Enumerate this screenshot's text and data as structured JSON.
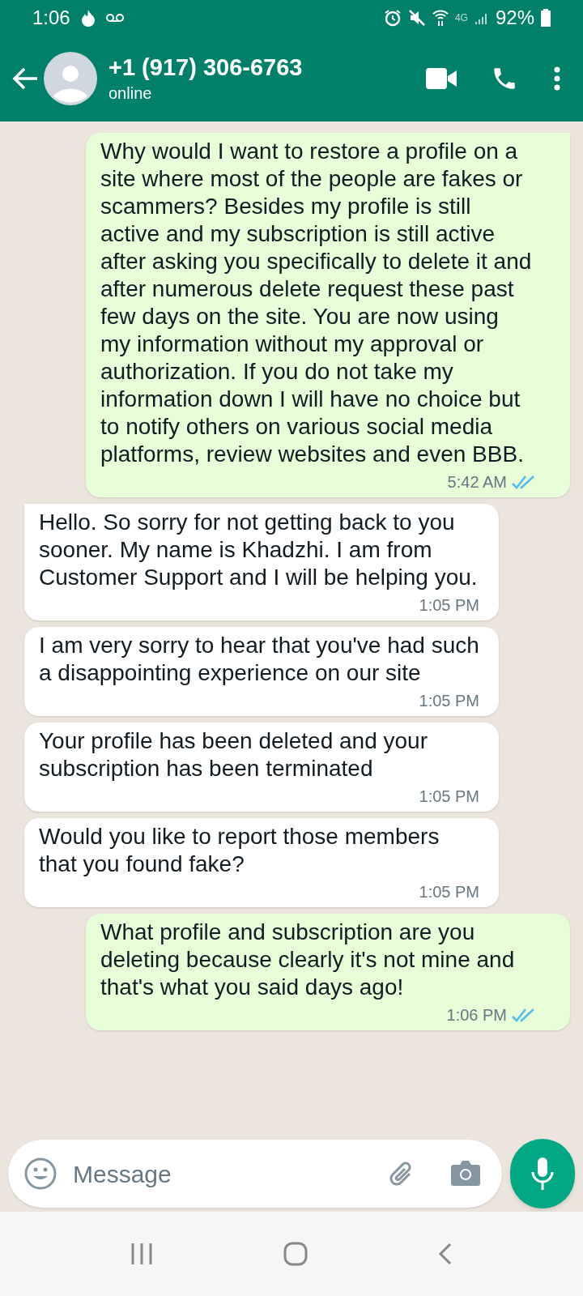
{
  "status_bar": {
    "time": "1:06",
    "battery": "92%",
    "network": "4G"
  },
  "header": {
    "title": "+1 (917) 306-6763",
    "subtitle": "online"
  },
  "messages": [
    {
      "kind": "outgoing",
      "text": "Why would I want to restore a profile on a site where most of the people are fakes or scammers? Besides my profile is still active and my subscription is still active after asking you specifically to delete it and after numerous delete request these past few days on the site. You are now using my information without my approval or authorization. If you do not take my information down I will have no choice but to notify others on various social media platforms, review websites and even BBB.",
      "time": "5:42 AM",
      "read": true,
      "tail": true
    },
    {
      "kind": "incoming",
      "text": "Hello. So sorry for not getting back to you sooner. My name is Khadzhi. I am from Customer Support and I will be helping you.",
      "time": "1:05 PM",
      "tail": true
    },
    {
      "kind": "incoming",
      "text": "I am very sorry to hear that you've had such a disappointing experience on our site",
      "time": "1:05 PM",
      "tail": false
    },
    {
      "kind": "incoming",
      "text": "Your profile has been deleted and your subscription has been terminated",
      "time": "1:05 PM",
      "tail": false
    },
    {
      "kind": "incoming",
      "text": "Would you like to report those members that you found fake?",
      "time": "1:05 PM",
      "tail": false
    },
    {
      "kind": "outgoing",
      "text": "What profile and subscription are you deleting because clearly it's not mine and that's what you said days ago!",
      "time": "1:06 PM",
      "read": true,
      "tail": false
    }
  ],
  "composer": {
    "placeholder": "Message"
  }
}
